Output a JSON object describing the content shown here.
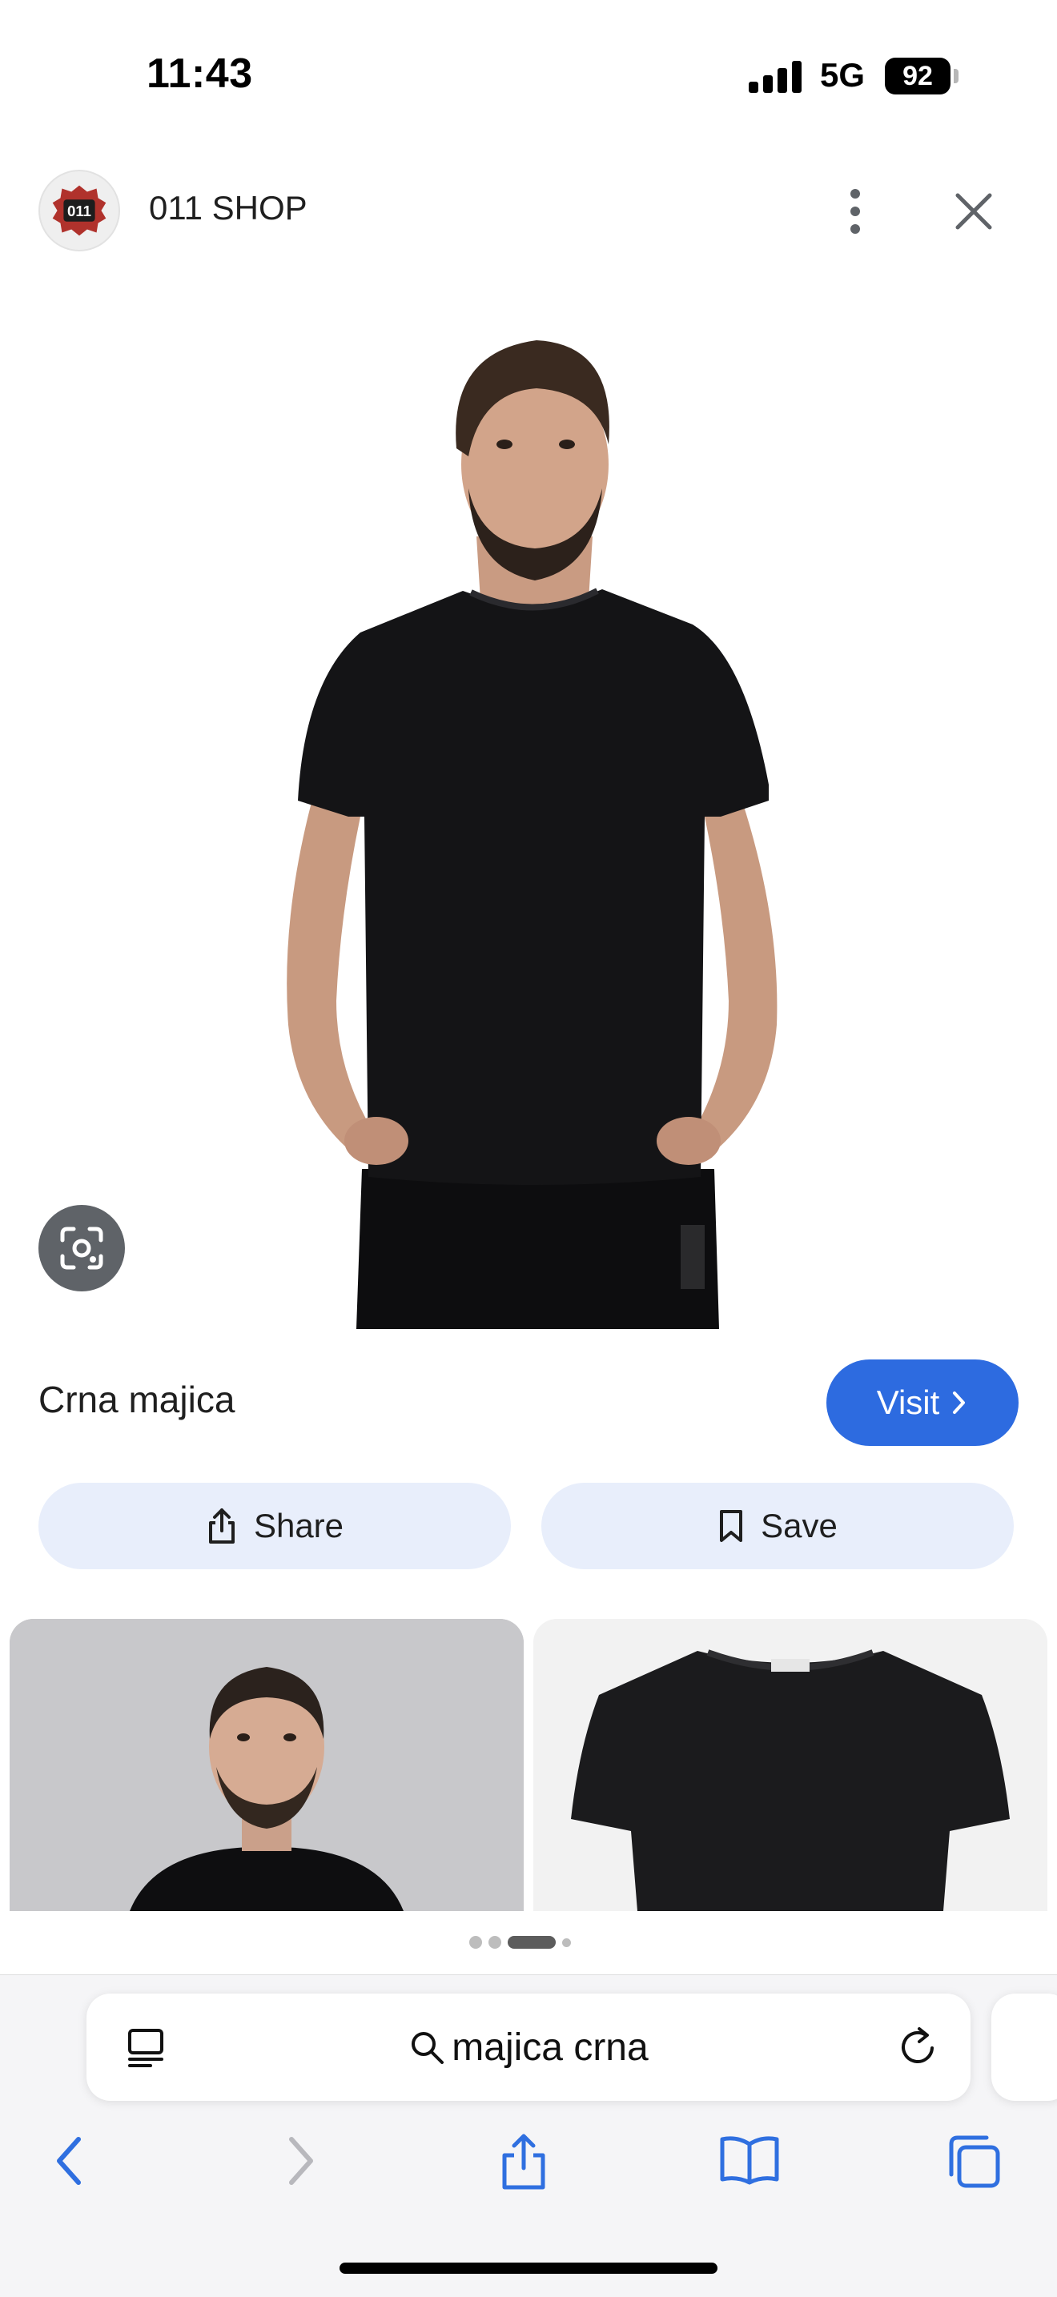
{
  "status_bar": {
    "time": "11:43",
    "network": "5G",
    "battery": "92"
  },
  "header": {
    "source_name": "011 SHOP",
    "logo_text": "011"
  },
  "result": {
    "title": "Crna majica",
    "visit_label": "Visit",
    "share_label": "Share",
    "save_label": "Save"
  },
  "related": [
    {
      "kind": "man-in-black-tshirt"
    },
    {
      "kind": "black-tshirt-product"
    }
  ],
  "pager": {
    "count": 4,
    "active": 2
  },
  "browser": {
    "search_query": "majica crna"
  },
  "icons": {
    "more": "more-vert-icon",
    "close": "close-icon",
    "lens": "google-lens-icon",
    "share": "share-icon",
    "save": "bookmark-icon",
    "reader": "reader-icon",
    "search": "search-icon",
    "reload": "reload-icon",
    "back": "back-icon",
    "forward": "forward-icon",
    "browser_share": "share-icon",
    "bookmarks": "bookmarks-icon",
    "tabs": "tabs-icon"
  },
  "colors": {
    "accent": "#2d6be0",
    "pill_bg": "#e8eefb",
    "lens_bg": "#5f6368"
  }
}
